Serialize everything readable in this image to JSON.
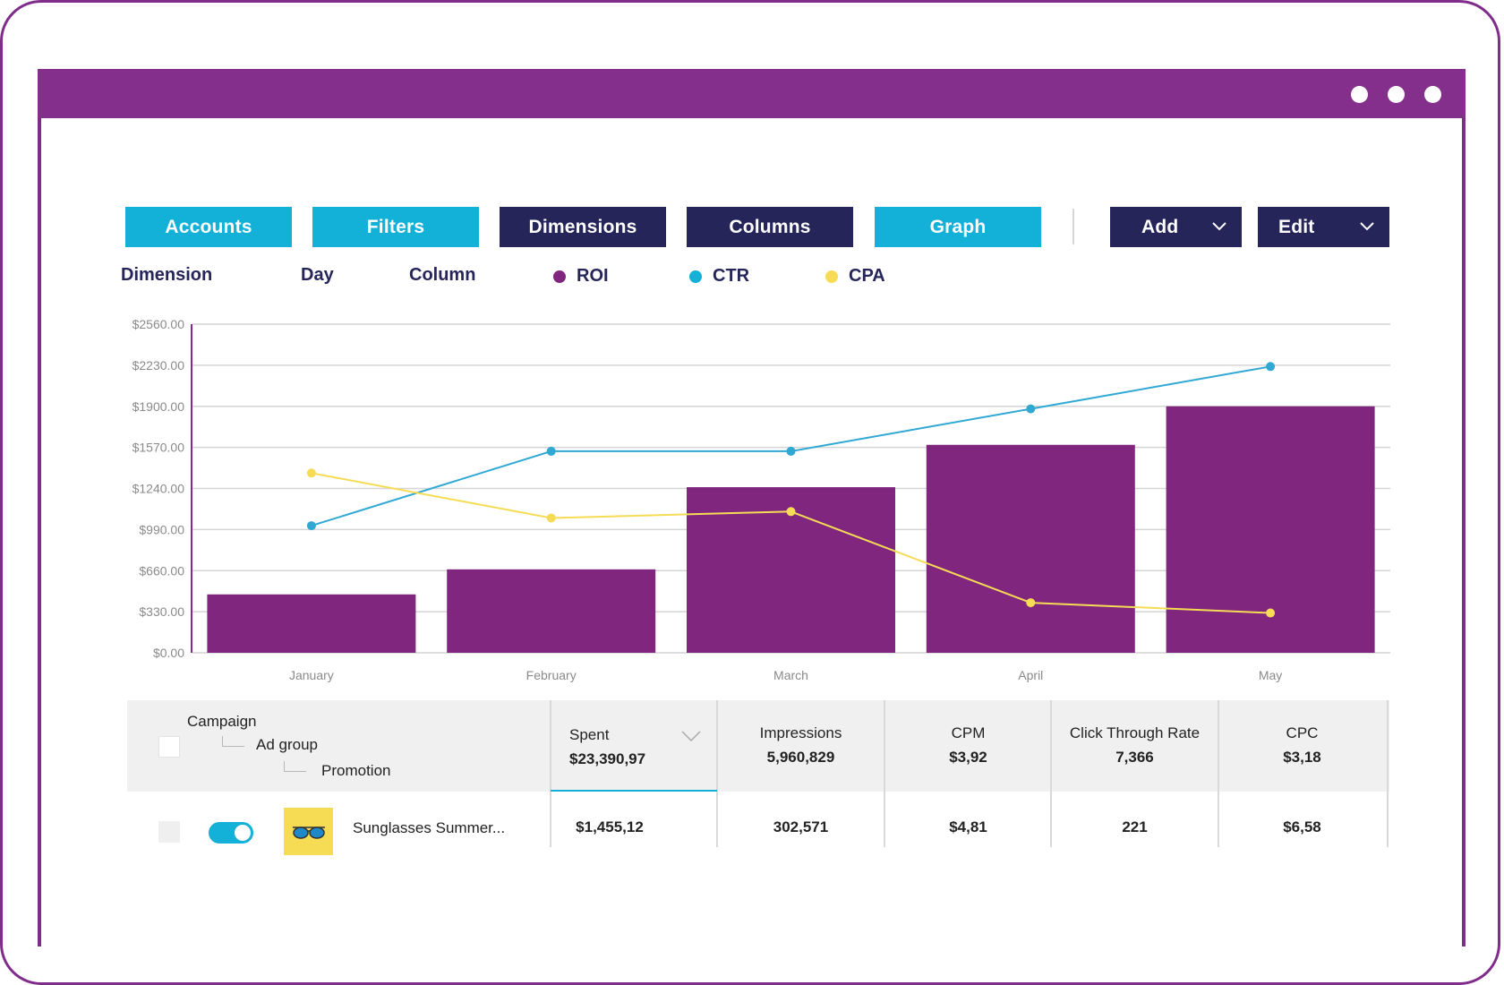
{
  "colors": {
    "frame": "#7f2c8a",
    "titlebar": "#842f8b",
    "cyan": "#13b0d7",
    "navy": "#25255a",
    "roi": "#80267f",
    "ctr": "#2fa8d4",
    "cpa": "#f6dc55"
  },
  "toolbar": {
    "accounts": "Accounts",
    "filters": "Filters",
    "dimensions": "Dimensions",
    "columns": "Columns",
    "graph": "Graph",
    "add": "Add",
    "edit": "Edit"
  },
  "controls": {
    "dimension_label": "Dimension",
    "dimension_value": "Day",
    "column_label": "Column"
  },
  "legend": [
    {
      "name": "ROI",
      "color": "#80267f"
    },
    {
      "name": "CTR",
      "color": "#13b0d7"
    },
    {
      "name": "CPA",
      "color": "#f6dc55"
    }
  ],
  "chart_data": {
    "type": "bar",
    "categories": [
      "January",
      "February",
      "March",
      "April",
      "May"
    ],
    "yticks": [
      "$0.00",
      "$330.00",
      "$660.00",
      "$990.00",
      "$1240.00",
      "$1570.00",
      "$1900.00",
      "$2230.00",
      "$2560.00"
    ],
    "ylim": [
      0,
      2560
    ],
    "grid": true,
    "series": [
      {
        "name": "ROI",
        "type": "bar",
        "values": [
          455,
          650,
          1290,
          1620,
          1920
        ]
      },
      {
        "name": "CTR",
        "type": "line",
        "values": [
          990,
          1570,
          1570,
          1900,
          2230
        ]
      },
      {
        "name": "CPA",
        "type": "line",
        "values": [
          1400,
          1050,
          1100,
          390,
          310
        ]
      }
    ]
  },
  "table": {
    "hierarchy": [
      "Campaign",
      "Ad group",
      "Promotion"
    ],
    "columns": [
      {
        "title": "Spent",
        "total": "$23,390,97"
      },
      {
        "title": "Impressions",
        "total": "5,960,829"
      },
      {
        "title": "CPM",
        "total": "$3,92"
      },
      {
        "title": "Click Through Rate",
        "total": "7,366"
      },
      {
        "title": "CPC",
        "total": "$3,18"
      }
    ],
    "rows": [
      {
        "name": "Sunglasses Summer...",
        "enabled": true,
        "thumbnail_icon": "sunglasses-icon",
        "values": [
          "$1,455,12",
          "302,571",
          "$4,81",
          "221",
          "$6,58"
        ]
      }
    ]
  }
}
